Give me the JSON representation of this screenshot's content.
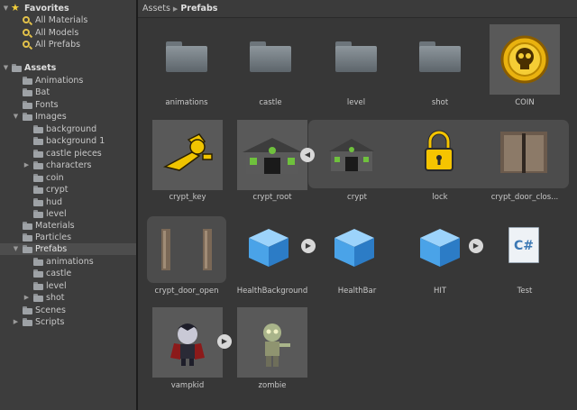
{
  "favorites": {
    "header": "Favorites",
    "items": [
      "All Materials",
      "All Models",
      "All Prefabs"
    ]
  },
  "assets": {
    "header": "Assets",
    "items": [
      {
        "label": "Animations"
      },
      {
        "label": "Bat"
      },
      {
        "label": "Fonts"
      },
      {
        "label": "Images",
        "expanded": true
      },
      {
        "label": "background"
      },
      {
        "label": "background 1"
      },
      {
        "label": "castle pieces"
      },
      {
        "label": "characters"
      },
      {
        "label": "coin"
      },
      {
        "label": "crypt"
      },
      {
        "label": "hud"
      },
      {
        "label": "level"
      },
      {
        "label": "Materials"
      },
      {
        "label": "Particles"
      },
      {
        "label": "Prefabs",
        "expanded": true,
        "selected": true
      },
      {
        "label": "animations"
      },
      {
        "label": "castle"
      },
      {
        "label": "level"
      },
      {
        "label": "shot"
      },
      {
        "label": "Scenes"
      },
      {
        "label": "Scripts"
      }
    ]
  },
  "breadcrumb": {
    "root": "Assets",
    "current": "Prefabs"
  },
  "grid": {
    "items": [
      "animations",
      "castle",
      "level",
      "shot",
      "COIN",
      "crypt_key",
      "crypt_root",
      "crypt",
      "lock",
      "crypt_door_clos...",
      "crypt_door_open",
      "HealthBackground",
      "HealthBar",
      "HIT",
      "Test",
      "vampkid",
      "zombie"
    ]
  },
  "script_icon_text": "C#",
  "colors": {
    "coin_gold": "#e9b20f",
    "cube_blue": "#4aa3e8",
    "lock_yellow": "#f5c400",
    "folder_gray": "#8d969c"
  },
  "icons": {
    "expand": "triangle-right",
    "collapse": "triangle-down",
    "folder": "folder-icon",
    "favorite": "star-icon",
    "search": "magnifier-icon"
  }
}
